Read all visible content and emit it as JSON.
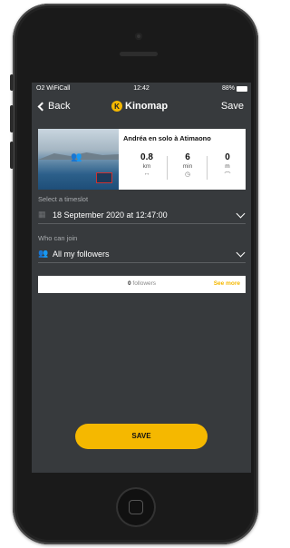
{
  "status_bar": {
    "carrier": "O2 WiFiCall",
    "time": "12:42",
    "battery": "88%"
  },
  "nav": {
    "back_label": "Back",
    "brand": "Kinomap",
    "brand_logo_glyph": "K",
    "save_label": "Save"
  },
  "video_card": {
    "title": "Andréa en solo à Atimaono",
    "stats": [
      {
        "value": "0.8",
        "unit": "km",
        "icon": "↔"
      },
      {
        "value": "6",
        "unit": "min",
        "icon": "◷"
      },
      {
        "value": "0",
        "unit": "m",
        "icon": "⌒"
      }
    ]
  },
  "timeslot": {
    "label": "Select a timeslot",
    "value": "18 September 2020 at 12:47:00"
  },
  "join": {
    "label": "Who can join",
    "value": "All my followers"
  },
  "followers_bar": {
    "count": "0",
    "count_suffix": "followers",
    "see_more": "See more"
  },
  "save_button": "SAVE",
  "colors": {
    "accent": "#f5b800",
    "screen_bg": "#373a3d"
  }
}
